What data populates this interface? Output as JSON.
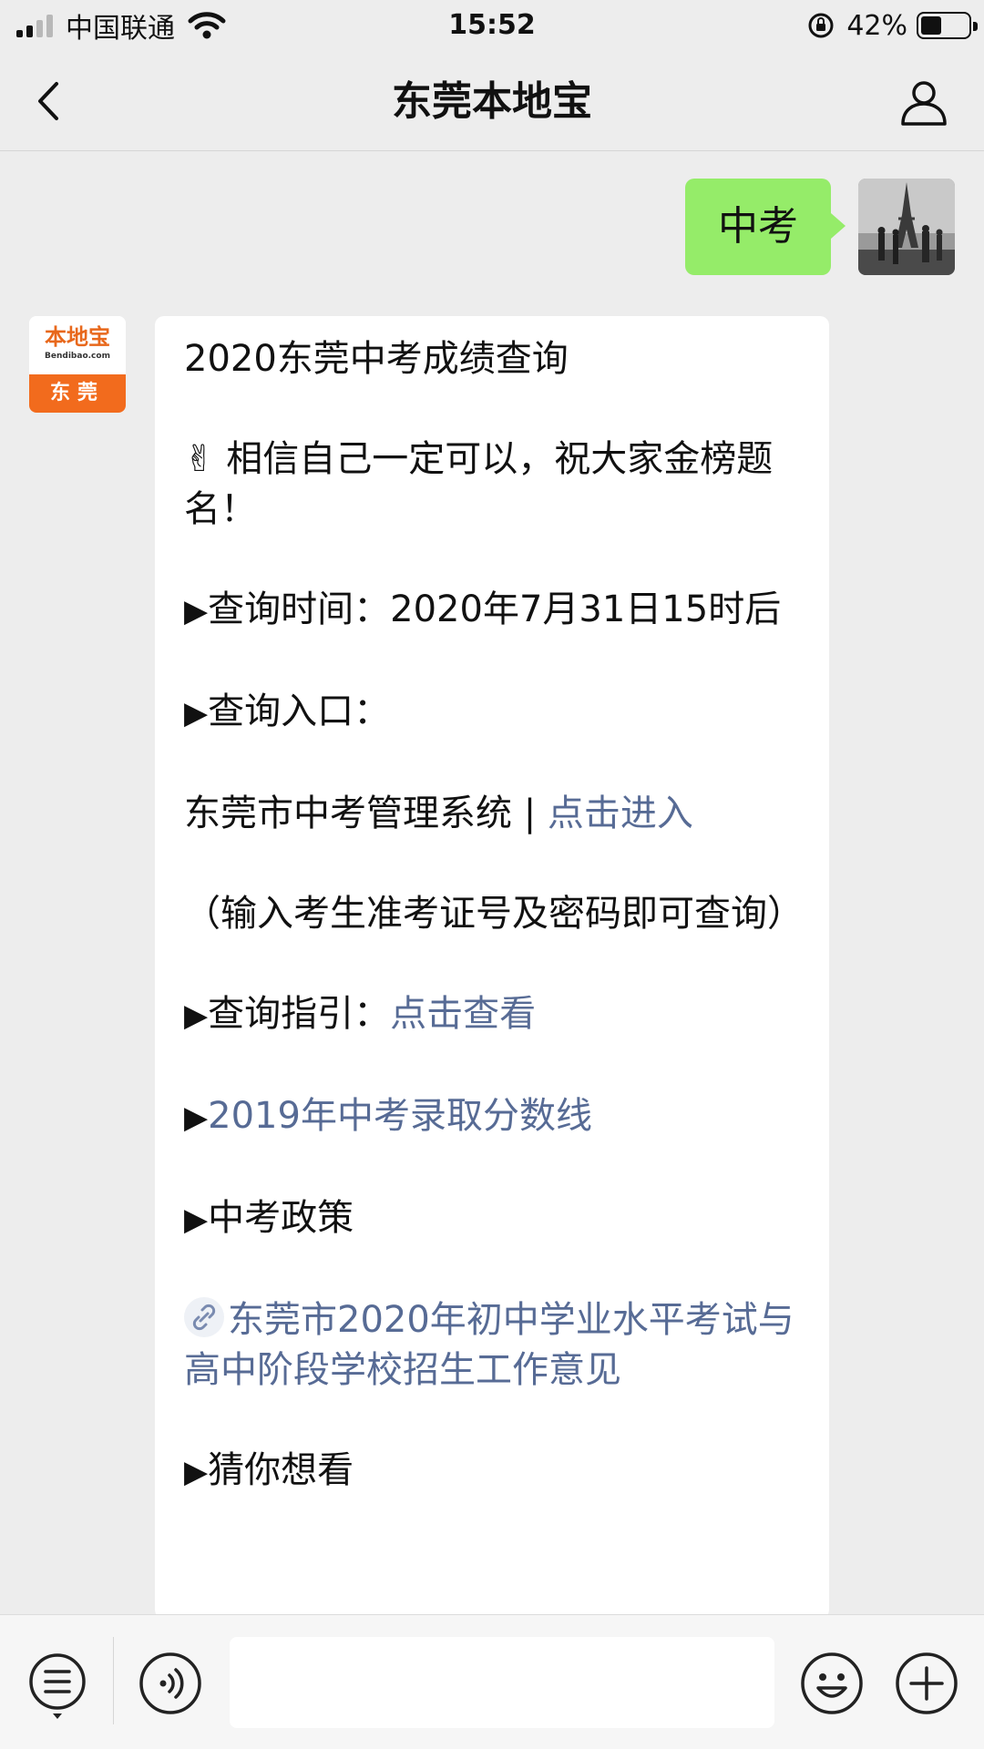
{
  "status_bar": {
    "carrier": "中国联通",
    "time": "15:52",
    "battery_pct": "42%"
  },
  "nav": {
    "title": "东莞本地宝"
  },
  "sent_message": {
    "text": "中考"
  },
  "bot": {
    "avatar_brand": "本地宝",
    "avatar_site": "Bendibao.com",
    "avatar_city": "东莞"
  },
  "reply": {
    "title": "2020东莞中考成绩查询",
    "wish_emoji": "✌",
    "wish": "相信自己一定可以，祝大家金榜题名！",
    "arrow": "▶",
    "query_time_label": "查询时间：",
    "query_time_value": "2020年7月31日15时后",
    "query_entry_label": "查询入口：",
    "system_name": "东莞市中考管理系统 | ",
    "system_link": "点击进入",
    "system_note": "（输入考生准考证号及密码即可查询）",
    "guide_label": "查询指引：",
    "guide_link": "点击查看",
    "score_line_link": "2019年中考录取分数线",
    "policy_label": "中考政策",
    "policy_link": "东莞市2020年初中学业水平考试与高中阶段学校招生工作意见",
    "guess_label": "猜你想看"
  },
  "colors": {
    "background": "#ededed",
    "sent_bubble": "#95ec69",
    "link": "#576b95",
    "brand_orange": "#f26b1d"
  },
  "icons": [
    "back-icon",
    "profile-icon",
    "menu-icon",
    "voice-icon",
    "emoji-icon",
    "plus-icon",
    "link-icon"
  ]
}
